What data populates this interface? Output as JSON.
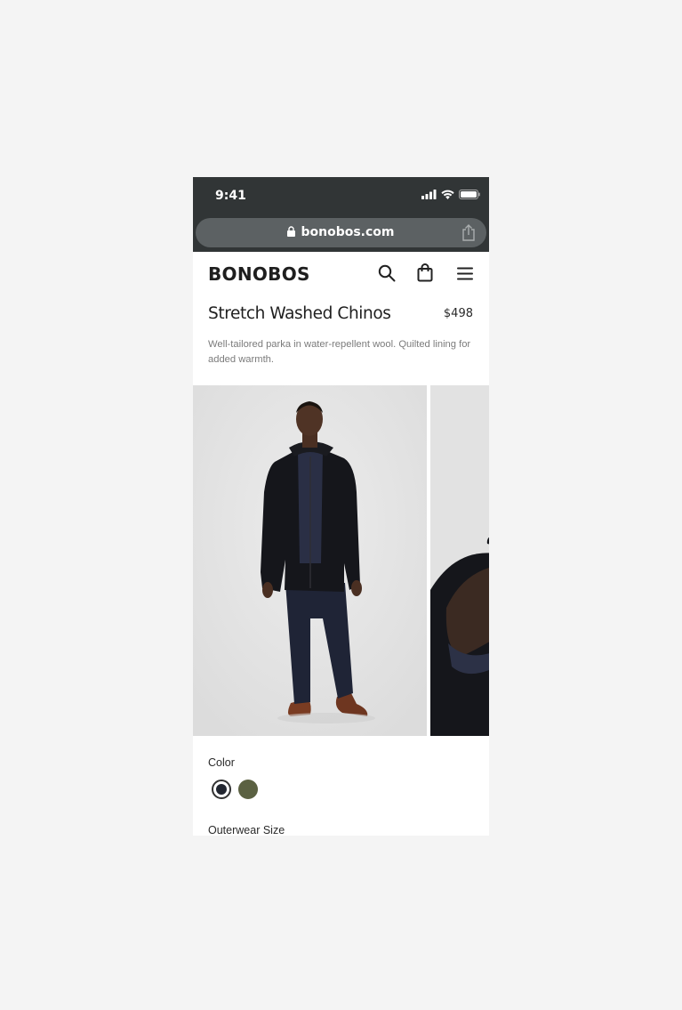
{
  "status": {
    "time": "9:41"
  },
  "browser": {
    "url": "bonobos.com"
  },
  "nav": {
    "logo": "BONOBOS"
  },
  "product": {
    "title": "Stretch Washed Chinos",
    "price": "$498",
    "description": "Well-tailored parka in water-repellent wool. Quilted lining for added warmth."
  },
  "options": {
    "color_label": "Color",
    "colors": [
      "#222630",
      "#5b6142"
    ],
    "selected_color_index": 0,
    "size_label": "Outerwear Size"
  },
  "icons": [
    "lock-icon",
    "share-icon",
    "search-icon",
    "bag-icon",
    "menu-icon",
    "signal-icon",
    "wifi-icon",
    "battery-icon"
  ]
}
